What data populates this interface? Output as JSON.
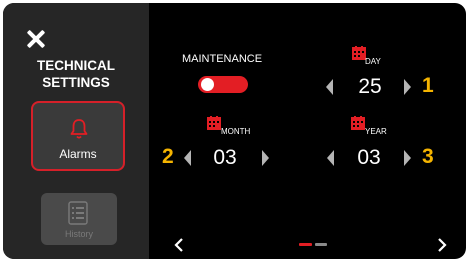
{
  "sidebar": {
    "title_line1": "TECHNICAL",
    "title_line2": "SETTINGS",
    "alarms_label": "Alarms",
    "history_label": "History"
  },
  "maintenance": {
    "label": "MAINTENANCE",
    "enabled": true
  },
  "date": {
    "day": {
      "label": "DAY",
      "value": "25",
      "step": "1"
    },
    "month": {
      "label": "MONTH",
      "value": "03",
      "step": "2"
    },
    "year": {
      "label": "YEAR",
      "value": "03",
      "step": "3"
    }
  },
  "pager": {
    "pages": 2,
    "active": 0
  },
  "colors": {
    "accent": "#e31e24",
    "step_number": "#f5b400",
    "background": "#000000",
    "sidebar": "#262626"
  }
}
